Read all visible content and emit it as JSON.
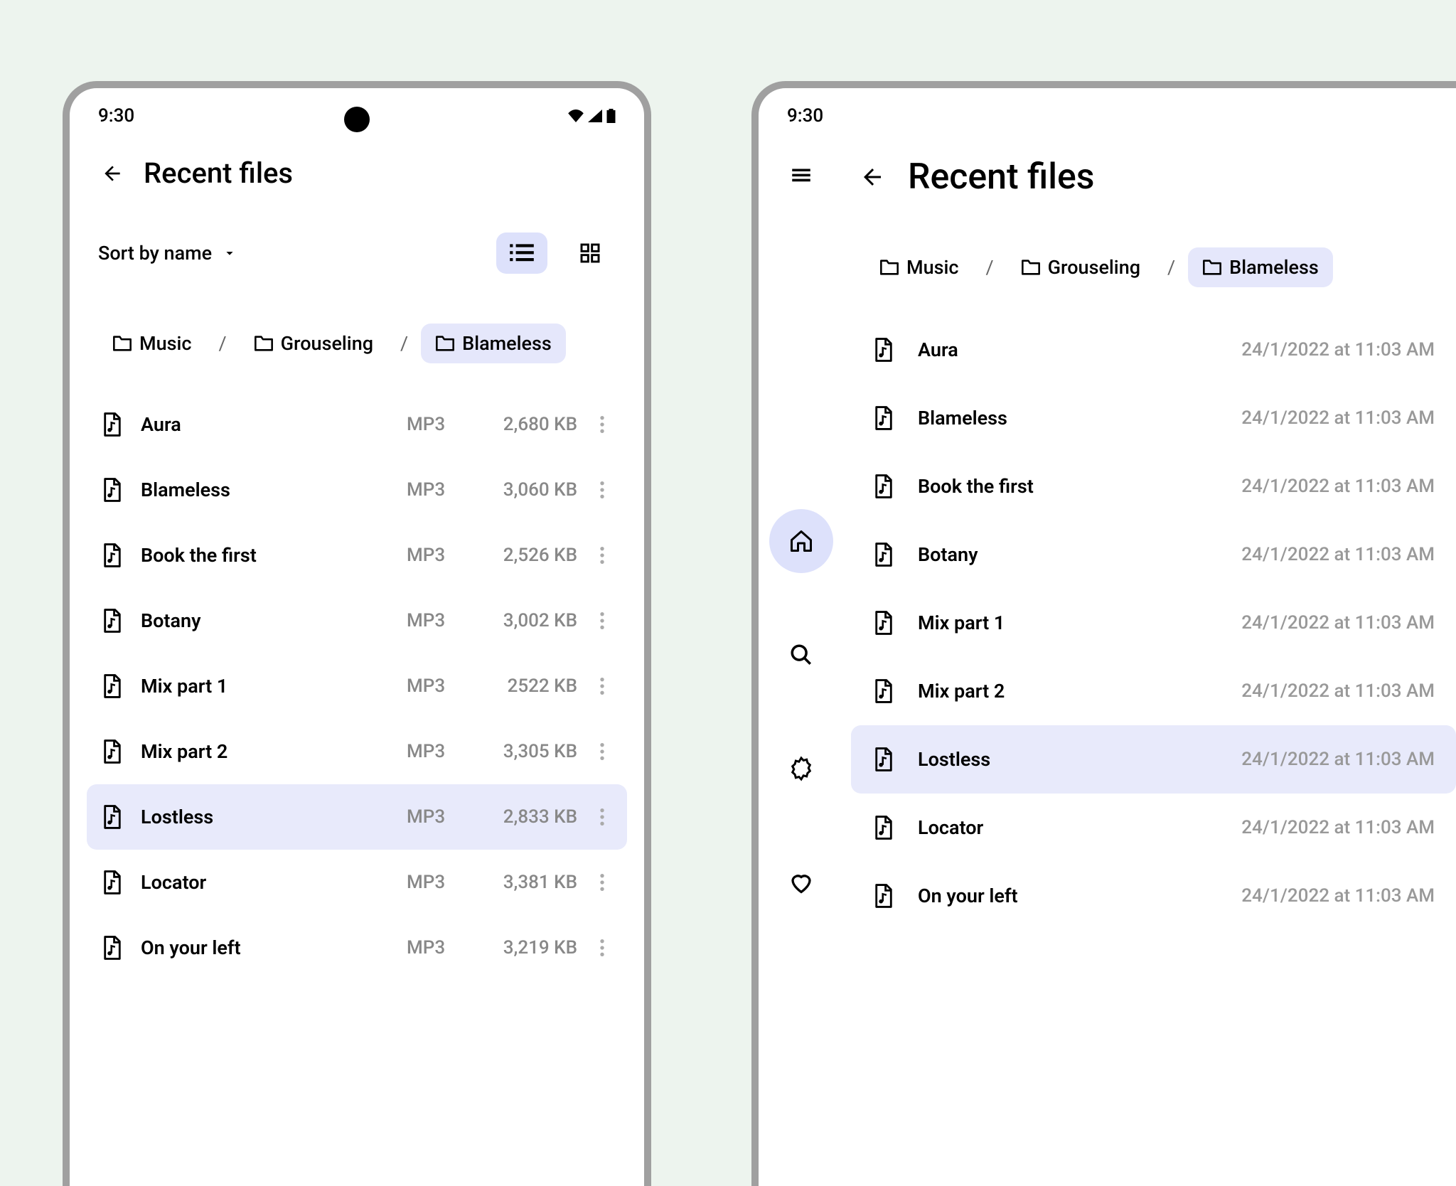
{
  "status": {
    "time": "9:30"
  },
  "header": {
    "title": "Recent files"
  },
  "sort": {
    "label": "Sort by name"
  },
  "breadcrumb": [
    {
      "label": "Music",
      "active": false
    },
    {
      "label": "Grouseling",
      "active": false
    },
    {
      "label": "Blameless",
      "active": true
    }
  ],
  "phone_files": [
    {
      "name": "Aura",
      "type": "MP3",
      "size": "2,680 KB",
      "selected": false
    },
    {
      "name": "Blameless",
      "type": "MP3",
      "size": "3,060 KB",
      "selected": false
    },
    {
      "name": "Book the first",
      "type": "MP3",
      "size": "2,526 KB",
      "selected": false
    },
    {
      "name": "Botany",
      "type": "MP3",
      "size": "3,002 KB",
      "selected": false
    },
    {
      "name": "Mix part 1",
      "type": "MP3",
      "size": "2522 KB",
      "selected": false
    },
    {
      "name": "Mix part 2",
      "type": "MP3",
      "size": "3,305 KB",
      "selected": false
    },
    {
      "name": "Lostless",
      "type": "MP3",
      "size": "2,833 KB",
      "selected": true
    },
    {
      "name": "Locator",
      "type": "MP3",
      "size": "3,381 KB",
      "selected": false
    },
    {
      "name": "On your left",
      "type": "MP3",
      "size": "3,219 KB",
      "selected": false
    }
  ],
  "tablet_files": [
    {
      "name": "Aura",
      "date": "24/1/2022 at 11:03 AM",
      "selected": false
    },
    {
      "name": "Blameless",
      "date": "24/1/2022 at 11:03 AM",
      "selected": false
    },
    {
      "name": "Book the first",
      "date": "24/1/2022 at 11:03 AM",
      "selected": false
    },
    {
      "name": "Botany",
      "date": "24/1/2022 at 11:03 AM",
      "selected": false
    },
    {
      "name": "Mix part 1",
      "date": "24/1/2022 at 11:03 AM",
      "selected": false
    },
    {
      "name": "Mix part 2",
      "date": "24/1/2022 at 11:03 AM",
      "selected": false
    },
    {
      "name": "Lostless",
      "date": "24/1/2022 at 11:03 AM",
      "selected": true
    },
    {
      "name": "Locator",
      "date": "24/1/2022 at 11:03 AM",
      "selected": false
    },
    {
      "name": "On your left",
      "date": "24/1/2022 at 11:03 AM",
      "selected": false
    }
  ]
}
